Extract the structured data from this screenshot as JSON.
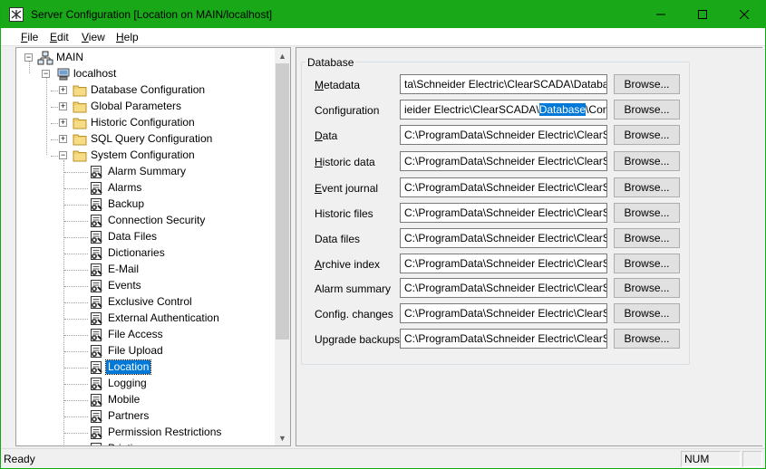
{
  "window": {
    "title": "Server Configuration [Location on MAIN/localhost]"
  },
  "menu": [
    "File",
    "Edit",
    "View",
    "Help"
  ],
  "tree": {
    "root": "MAIN",
    "host": "localhost",
    "top_items": [
      "Database Configuration",
      "Global Parameters",
      "Historic Configuration",
      "SQL Query Configuration",
      "System Configuration"
    ],
    "system_items": [
      "Alarm Summary",
      "Alarms",
      "Backup",
      "Connection Security",
      "Data Files",
      "Dictionaries",
      "E-Mail",
      "Events",
      "Exclusive Control",
      "External Authentication",
      "File Access",
      "File Upload",
      "Location",
      "Logging",
      "Mobile",
      "Partners",
      "Permission Restrictions",
      "Printing"
    ],
    "selected": "Location"
  },
  "database": {
    "group_title": "Database",
    "browse_label": "Browse...",
    "fields": [
      {
        "label": "Metadata",
        "underline": "M",
        "rest": "etadata",
        "value": "ta\\Schneider Electric\\ClearSCADA\\Database\\"
      },
      {
        "label": "Configuration",
        "underline": "",
        "rest": "Configuration",
        "value_pre": "ieider Electric\\ClearSCADA\\",
        "value_sel": "Database",
        "value_post": "\\Config\\"
      },
      {
        "label": "Data",
        "underline": "D",
        "rest": "ata",
        "value": "C:\\ProgramData\\Schneider Electric\\ClearSCADA\\"
      },
      {
        "label": "Historic data",
        "underline": "H",
        "rest": "istoric data",
        "value": "C:\\ProgramData\\Schneider Electric\\ClearSCADA\\"
      },
      {
        "label": "Event journal",
        "underline": "E",
        "rest": "vent journal",
        "value": "C:\\ProgramData\\Schneider Electric\\ClearSCADA\\"
      },
      {
        "label": "Historic files",
        "underline": "",
        "rest": "Historic files",
        "value": "C:\\ProgramData\\Schneider Electric\\ClearSCADA\\"
      },
      {
        "label": "Data files",
        "underline": "",
        "rest": "Data files",
        "value": "C:\\ProgramData\\Schneider Electric\\ClearSCADA\\"
      },
      {
        "label": "Archive index",
        "underline": "A",
        "rest": "rchive index",
        "value": "C:\\ProgramData\\Schneider Electric\\ClearSCADA\\"
      },
      {
        "label": "Alarm summary",
        "underline": "",
        "rest": "Alarm summary",
        "value": "C:\\ProgramData\\Schneider Electric\\ClearSCADA\\"
      },
      {
        "label": "Config. changes",
        "underline": "",
        "rest": "Config. changes",
        "value": "C:\\ProgramData\\Schneider Electric\\ClearSCADA\\"
      },
      {
        "label": "Upgrade backups",
        "underline": "",
        "rest": "Upgrade backups",
        "value": "C:\\ProgramData\\Schneider Electric\\ClearSCADA\\"
      }
    ]
  },
  "status": {
    "text": "Ready",
    "num": "NUM"
  },
  "colors": {
    "titlebar": "#18a818",
    "selection": "#0078d7"
  }
}
